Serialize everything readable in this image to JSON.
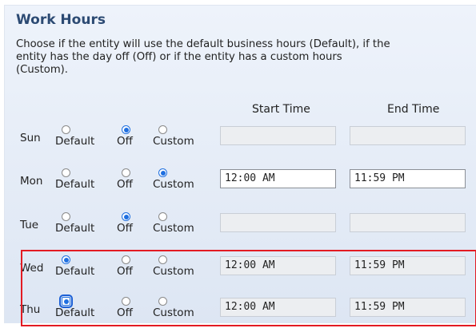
{
  "section": {
    "title": "Work Hours",
    "description": "Choose if the entity will use the default business hours (Default), if the entity has the day off (Off) or if the entity has a custom hours (Custom)."
  },
  "columns": {
    "start": "Start Time",
    "end": "End Time"
  },
  "options": {
    "default": "Default",
    "off": "Off",
    "custom": "Custom"
  },
  "days": [
    {
      "label": "Sun",
      "selected": "off",
      "start": "",
      "end": "",
      "editable": false
    },
    {
      "label": "Mon",
      "selected": "custom",
      "start": "12:00 AM",
      "end": "11:59 PM",
      "editable": true
    },
    {
      "label": "Tue",
      "selected": "off",
      "start": "",
      "end": "",
      "editable": false
    },
    {
      "label": "Wed",
      "selected": "default",
      "start": "12:00 AM",
      "end": "11:59 PM",
      "editable": false
    },
    {
      "label": "Thu",
      "selected": "default",
      "start": "12:00 AM",
      "end": "11:59 PM",
      "editable": false,
      "focused": true
    }
  ],
  "highlight_color": "#e31b23",
  "accent_color": "#1f6fe0"
}
